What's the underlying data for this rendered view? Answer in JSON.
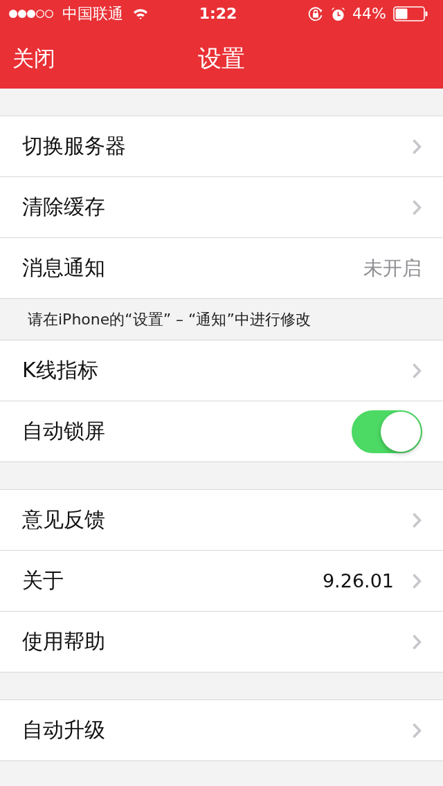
{
  "status_bar": {
    "carrier": "中国联通",
    "time": "1:22",
    "battery": "44%"
  },
  "nav_bar": {
    "left_button": "关闭",
    "title": "设置"
  },
  "sections": [
    {
      "rows": [
        {
          "kind": "link",
          "label": "切换服务器"
        },
        {
          "kind": "link",
          "label": "清除缓存"
        },
        {
          "kind": "value",
          "label": "消息通知",
          "value": "未开启"
        }
      ],
      "footer": "请在iPhone的“设置” – “通知”中进行修改"
    },
    {
      "rows": [
        {
          "kind": "link",
          "label": "K线指标"
        },
        {
          "kind": "switch",
          "label": "自动锁屏",
          "on": true
        }
      ]
    },
    {
      "rows": [
        {
          "kind": "link",
          "label": "意见反馈"
        },
        {
          "kind": "link",
          "label": "关于",
          "value": "9.26.01"
        },
        {
          "kind": "link",
          "label": "使用帮助"
        }
      ]
    },
    {
      "rows": [
        {
          "kind": "link",
          "label": "自动升级"
        }
      ]
    }
  ]
}
